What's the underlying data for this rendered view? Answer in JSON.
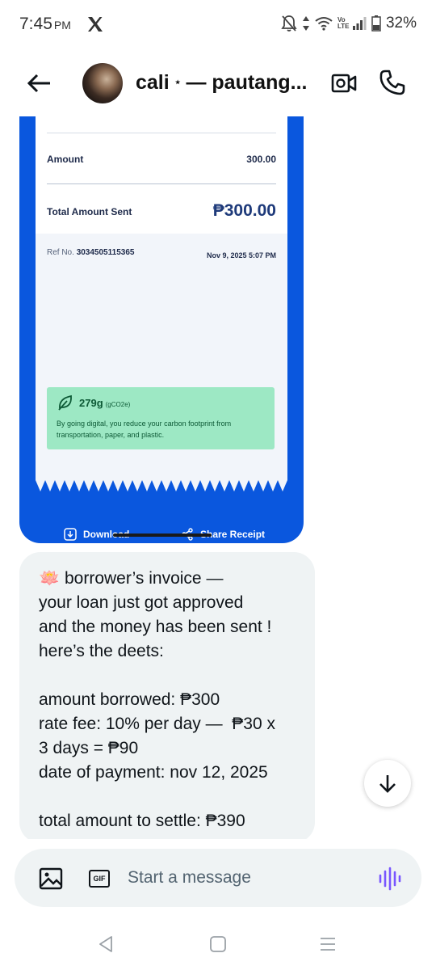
{
  "status_bar": {
    "time": "7:45",
    "ampm": "PM",
    "battery": "32%",
    "volte": "Vo LTE"
  },
  "header": {
    "chat_name": "cali",
    "star": "⋆",
    "chat_suffix": "— pautang..."
  },
  "receipt": {
    "amount_label": "Amount",
    "amount_value": "300.00",
    "total_label": "Total Amount Sent",
    "total_value": "₱300.00",
    "ref_label": "Ref No.",
    "ref_number": "3034505115365",
    "date": "Nov 9, 2025 5:07 PM",
    "carbon_value": "279g",
    "carbon_unit": "(gCO2e)",
    "carbon_text": "By going digital, you reduce your carbon footprint from transportation, paper, and plastic.",
    "download_label": "Download",
    "share_label": "Share Receipt"
  },
  "message": {
    "lines": [
      "🪷 borrower’s invoice —",
      "your loan just got approved",
      "and the money has been sent !",
      "here’s the deets:",
      "",
      "amount borrowed: ₱300",
      "rate fee: 10% per day —  ₱30 x",
      "3 days = ₱90",
      "date of payment: nov 12, 2025",
      "",
      "total amount to settle: ₱390"
    ]
  },
  "composer": {
    "placeholder": "Start a message",
    "gif_label": "GIF"
  },
  "colors": {
    "receipt_blue": "#0a57de",
    "carbon_green": "#9de8c4",
    "bubble_gray": "#eff3f4",
    "voice_purple": "#7856ff"
  }
}
